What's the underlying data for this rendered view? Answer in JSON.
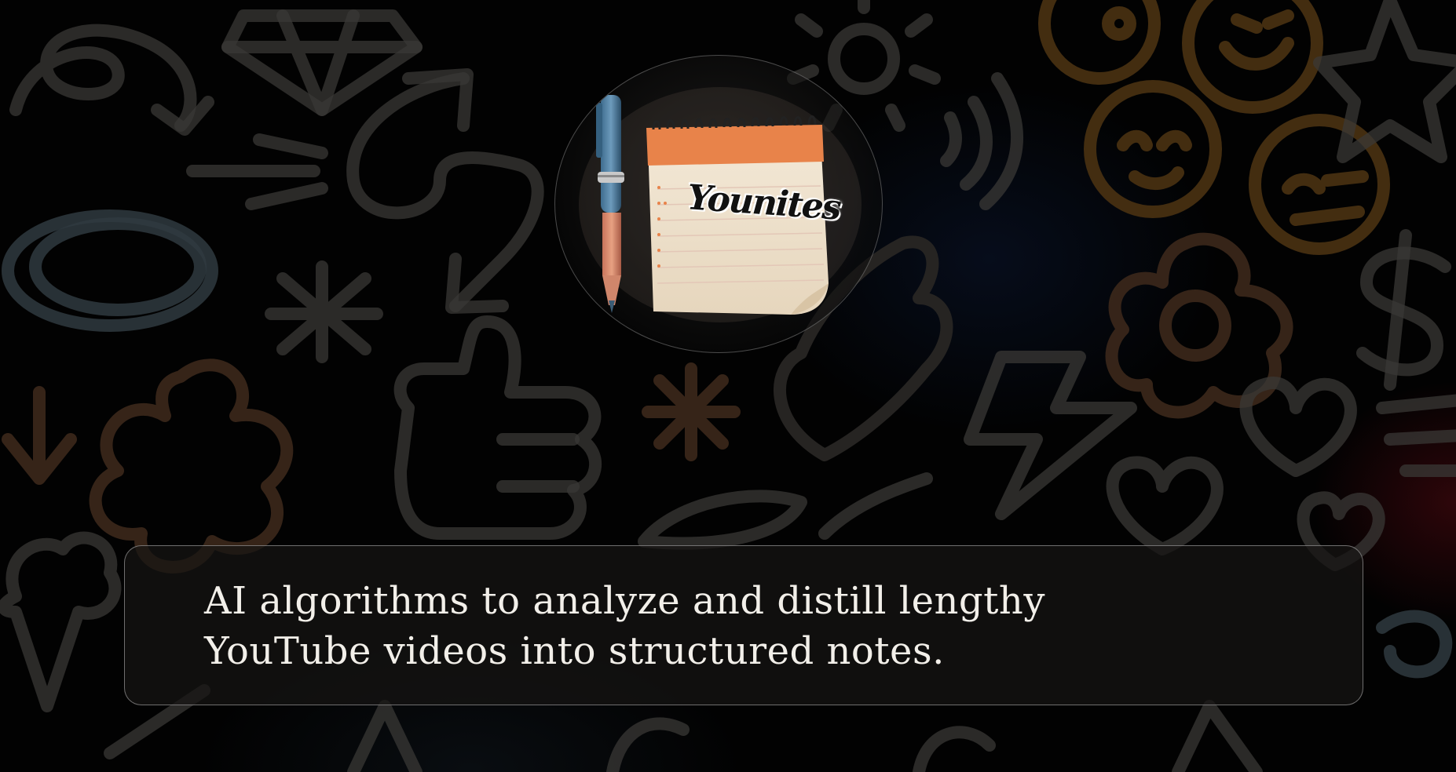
{
  "logo": {
    "wordmark": "Younites",
    "icon": "notepad-with-pen-icon"
  },
  "caption": {
    "line1": "AI algorithms to analyze and distill lengthy",
    "line2": "YouTube videos into structured notes."
  },
  "background": {
    "icons": [
      "diamond-icon",
      "arrow-icon",
      "sun-icon",
      "smiley-icon",
      "star-icon",
      "flower-icon",
      "thumbs-up-icon",
      "lightning-icon",
      "heart-icon",
      "dollar-icon",
      "ice-cream-icon",
      "asterisk-icon",
      "sound-waves-icon"
    ]
  },
  "colors": {
    "background": "#020202",
    "doodle_grey": "#3a3836",
    "doodle_amber": "#4a3212",
    "card_border": "#bebebe",
    "caption_text": "#f2efe9",
    "notepad_orange": "#e8834a"
  }
}
